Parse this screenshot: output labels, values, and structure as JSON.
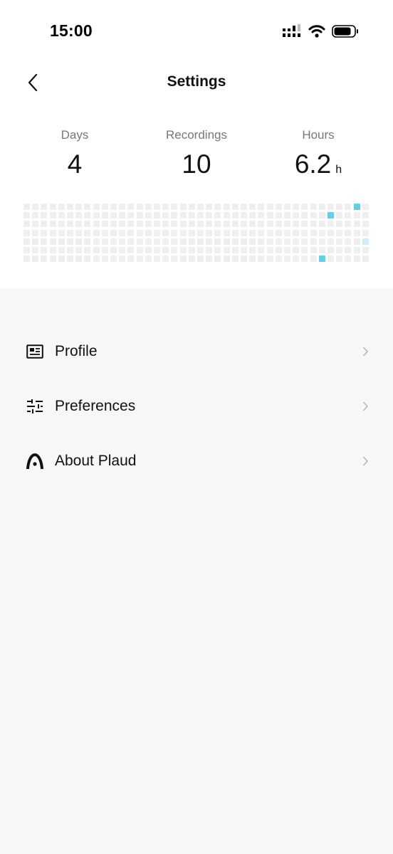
{
  "status_bar": {
    "time": "15:00"
  },
  "nav": {
    "title": "Settings"
  },
  "stats": [
    {
      "label": "Days",
      "value": "4",
      "unit": ""
    },
    {
      "label": "Recordings",
      "value": "10",
      "unit": ""
    },
    {
      "label": "Hours",
      "value": "6.2",
      "unit": "h"
    }
  ],
  "heatmap": {
    "columns": 40,
    "rows": 7,
    "empty_color": "#efefef",
    "active_cells": [
      {
        "col": 38,
        "row": 0,
        "level": 2
      },
      {
        "col": 35,
        "row": 1,
        "level": 2
      },
      {
        "col": 39,
        "row": 4,
        "level": 1
      },
      {
        "col": 34,
        "row": 6,
        "level": 2
      }
    ],
    "level_colors": {
      "1": "#cdeef7",
      "2": "#5fd0ea"
    }
  },
  "menu": {
    "items": [
      {
        "label": "Profile",
        "icon": "id-card-icon"
      },
      {
        "label": "Preferences",
        "icon": "sliders-icon"
      },
      {
        "label": "About Plaud",
        "icon": "plaud-logo-icon"
      }
    ]
  },
  "colors": {
    "background": "#f7f7f7",
    "header_background": "#ffffff",
    "accent": "#5fd0ea"
  }
}
